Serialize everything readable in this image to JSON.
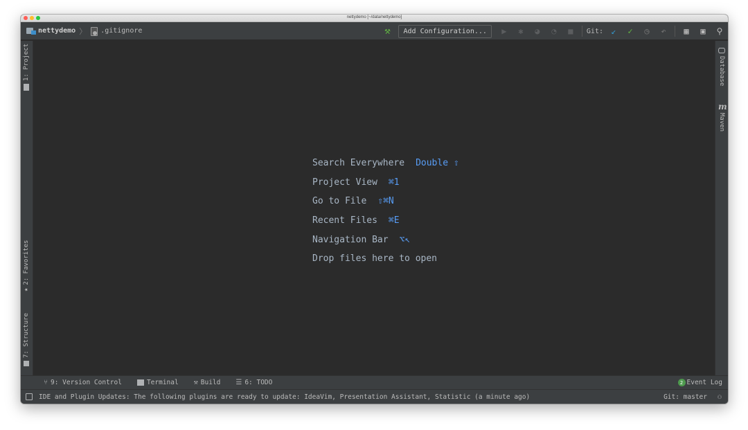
{
  "window": {
    "title": "nettydemo [~/data/nettydemo]"
  },
  "navbar": {
    "project": "nettydemo",
    "separator": "〉",
    "file": ".gitignore",
    "add_configuration": "Add Configuration...",
    "git_label": "Git:"
  },
  "left_tabs": {
    "project": "1: Project",
    "favorites": "2: Favorites",
    "structure": "7: Structure"
  },
  "right_tabs": {
    "database": "Database",
    "maven": "Maven",
    "maven_glyph": "m"
  },
  "hints": [
    {
      "label": "Search Everywhere",
      "key": "Double ⇧"
    },
    {
      "label": "Project View",
      "key": "⌘1"
    },
    {
      "label": "Go to File",
      "key": "⇧⌘N"
    },
    {
      "label": "Recent Files",
      "key": "⌘E"
    },
    {
      "label": "Navigation Bar",
      "key": "⌥↖"
    },
    {
      "label": "Drop files here to open",
      "key": ""
    }
  ],
  "tool_windows": {
    "version_control": "9: Version Control",
    "terminal": "Terminal",
    "build": "Build",
    "todo": "6: TODO",
    "event_log": "Event Log",
    "event_count": "2"
  },
  "status": {
    "message": "IDE and Plugin Updates: The following plugins are ready to update: IdeaVim, Presentation Assistant, Statistic (a minute ago)",
    "git_branch": "Git: master"
  },
  "colors": {
    "editor_bg": "#2b2b2b",
    "chrome_bg": "#3c3f41",
    "hint_text": "#a9b7c6",
    "hint_key": "#589df6",
    "git_update": "#3592c4",
    "git_commit": "#62b543"
  },
  "icons": [
    "hammer-icon",
    "run-icon",
    "debug-icon",
    "coverage-icon",
    "profile-icon",
    "stop-icon",
    "git-update-icon",
    "git-commit-icon",
    "history-icon",
    "rollback-icon",
    "project-structure-icon",
    "layout-icon",
    "search-icon"
  ]
}
